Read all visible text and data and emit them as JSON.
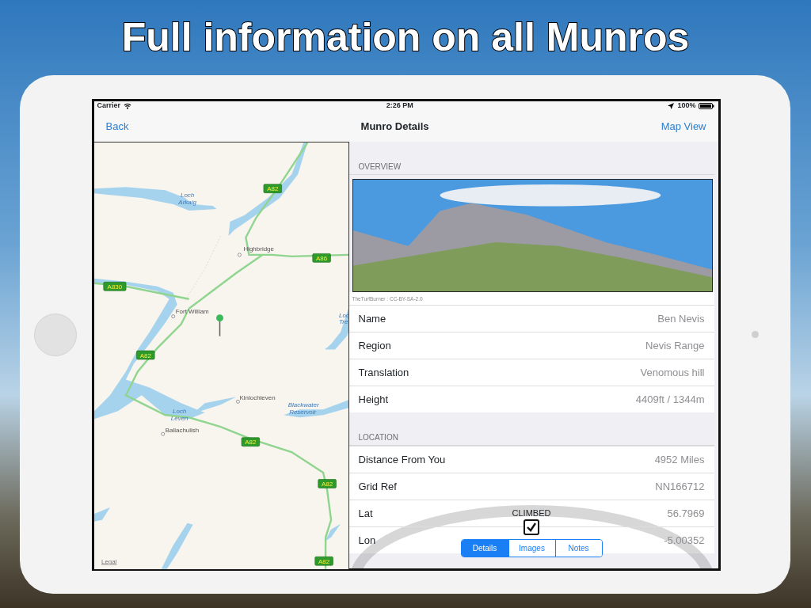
{
  "headline": "Full information on all Munros",
  "status_bar": {
    "carrier": "Carrier",
    "time": "2:26 PM",
    "battery": "100%"
  },
  "nav": {
    "back": "Back",
    "title": "Munro Details",
    "right": "Map View"
  },
  "map": {
    "labels": [
      {
        "text": "Loch",
        "kind": "water"
      },
      {
        "text": "Arkaig",
        "kind": "water"
      },
      {
        "text": "A82",
        "kind": "road"
      },
      {
        "text": "Highbridge",
        "kind": "place"
      },
      {
        "text": "A86",
        "kind": "road"
      },
      {
        "text": "A830",
        "kind": "road"
      },
      {
        "text": "Fort William",
        "kind": "place"
      },
      {
        "text": "Loc",
        "kind": "water"
      },
      {
        "text": "Tre",
        "kind": "water"
      },
      {
        "text": "A82",
        "kind": "road"
      },
      {
        "text": "Kinlochleven",
        "kind": "place"
      },
      {
        "text": "Loch",
        "kind": "water"
      },
      {
        "text": "Leven",
        "kind": "water"
      },
      {
        "text": "Blackwater",
        "kind": "water"
      },
      {
        "text": "Reservoir",
        "kind": "water"
      },
      {
        "text": "Ballachulish",
        "kind": "place"
      },
      {
        "text": "A82",
        "kind": "road"
      },
      {
        "text": "A82",
        "kind": "road"
      },
      {
        "text": "Legal",
        "kind": "legal"
      },
      {
        "text": "A82",
        "kind": "road"
      }
    ]
  },
  "sections": [
    {
      "header": "OVERVIEW",
      "photo": {
        "credit": "TheTurfBurner : CC-BY-SA-2.0"
      },
      "rows": [
        {
          "label": "Name",
          "value": "Ben Nevis"
        },
        {
          "label": "Region",
          "value": "Nevis Range"
        },
        {
          "label": "Translation",
          "value": "Venomous hill"
        },
        {
          "label": "Height",
          "value": "4409ft / 1344m"
        }
      ]
    },
    {
      "header": "LOCATION",
      "rows": [
        {
          "label": "Distance From You",
          "value": "4952 Miles"
        },
        {
          "label": "Grid Ref",
          "value": "NN166712"
        },
        {
          "label": "Lat",
          "value": "56.7969"
        },
        {
          "label": "Lon",
          "value": "-5.00352"
        }
      ]
    }
  ],
  "climbed": {
    "label": "CLIMBED",
    "checked": true
  },
  "segments": [
    {
      "label": "Details",
      "selected": true
    },
    {
      "label": "Images",
      "selected": false
    },
    {
      "label": "Notes",
      "selected": false
    }
  ]
}
